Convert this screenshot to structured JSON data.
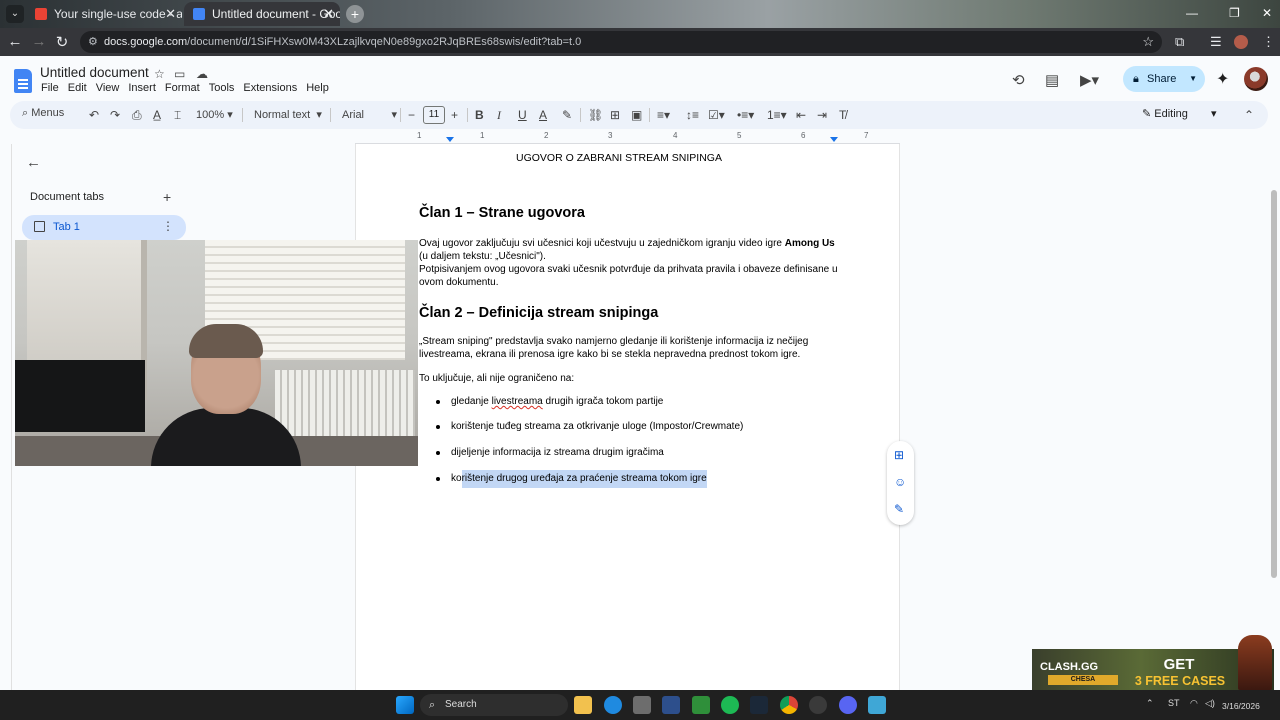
{
  "browser": {
    "tabs": [
      {
        "label": "Your single-use code - arminc",
        "active": false
      },
      {
        "label": "Untitled document - Google Do",
        "active": true
      }
    ],
    "url_host": "docs.google.com",
    "url_path": "/document/d/1SiFHXsw0M43XLzajlkvqeN0e89gxo2RJqBREs68swis/edit?tab=t.0"
  },
  "docs": {
    "title": "Untitled document",
    "menu": [
      "File",
      "Edit",
      "View",
      "Insert",
      "Format",
      "Tools",
      "Extensions",
      "Help"
    ],
    "share_label": "Share"
  },
  "toolbar": {
    "menus_label": "Menus",
    "zoom": "100%",
    "style": "Normal text",
    "font": "Arial",
    "font_size": "11",
    "mode": "Editing"
  },
  "ruler": {
    "numbers": [
      "1",
      "1",
      "2",
      "3",
      "4",
      "5",
      "6",
      "7"
    ]
  },
  "sidebar": {
    "tabs_title": "Document tabs",
    "tab_label": "Tab 1"
  },
  "document": {
    "heading": "UGOVOR O ZABRANI STREAM SNIPINGA",
    "section1_title": "Član 1 – Strane ugovora",
    "section1_p1_a": "Ovaj ugovor zaključuju svi učesnici koji učestvuju u zajedničkom igranju video igre ",
    "section1_p1_bold": "Among Us",
    "section1_p1_b": "(u daljem tekstu: „Učesnici\").",
    "section1_p2": " Potpisivanjem ovog ugovora svaki učesnik potvrđuje da prihvata pravila i obaveze definisane u ovom dokumentu.",
    "section2_title": "Član 2 – Definicija stream snipinga",
    "section2_p1": "„Stream sniping\" predstavlja svako namjerno gledanje ili korištenje informacija iz nečijeg livestreama, ekrana ili prenosa igre kako bi se stekla nepravedna prednost tokom igre.",
    "section2_p2": "To uključuje, ali nije ograničeno na:",
    "bullet1_a": "gledanje ",
    "bullet1_underlined": "livestreama",
    "bullet1_b": " drugih igrača tokom partije",
    "bullet2": "korištenje tuđeg streama za otkrivanje uloge (Impostor/Crewmate)",
    "bullet3": "dijeljenje informacija iz streama drugim igračima",
    "bullet4_a": "ko",
    "bullet4_selected": "rištenje drugog uređaja za praćenje streama tokom igre"
  },
  "ad": {
    "brand": "CLASH.GG",
    "sub": "CHESA",
    "cta_line1": "GET",
    "cta_line2": "3 FREE CASES"
  },
  "taskbar": {
    "search_placeholder": "Search",
    "lang": "ST",
    "date": "3/16/2026"
  },
  "colors": {
    "accent": "#0b57d0",
    "share_bg": "#c2e7ff",
    "selection": "#c2d7f5",
    "toolbar_bg": "#edf2fa"
  }
}
